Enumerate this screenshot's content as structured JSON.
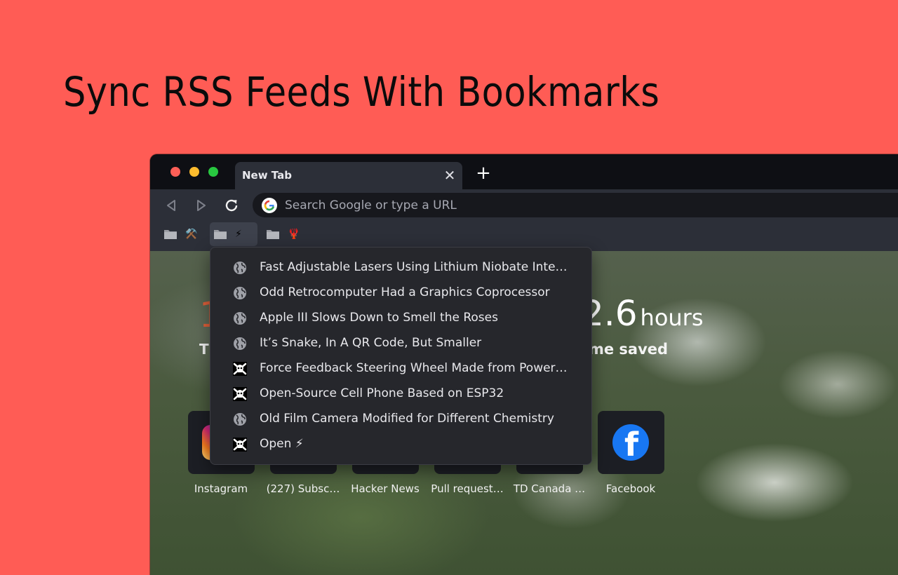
{
  "headline": "Sync RSS Feeds With Bookmarks",
  "colors": {
    "background": "#ff5c55",
    "accent_orange": "#e0603a",
    "facebook_blue": "#1877f2"
  },
  "browser": {
    "tab": {
      "title": "New Tab",
      "close_icon": "close-icon"
    },
    "new_tab_icon": "plus-icon",
    "nav": {
      "back_icon": "back-arrow-icon",
      "forward_icon": "forward-arrow-icon",
      "reload_icon": "reload-icon"
    },
    "omnibox": {
      "placeholder": "Search Google or type a URL",
      "icon": "google-icon"
    }
  },
  "bookmarks_bar": [
    {
      "icon": "folder-icon",
      "emoji": "⚒️"
    },
    {
      "icon": "folder-icon",
      "emoji": "⚡"
    },
    {
      "icon": "folder-icon",
      "emoji": "🦞"
    }
  ],
  "dropdown": {
    "items": [
      {
        "icon": "globe-icon",
        "label": "Fast Adjustable Lasers Using Lithium Niobate Integ…"
      },
      {
        "icon": "globe-icon",
        "label": "Odd Retrocomputer Had a Graphics Coprocessor"
      },
      {
        "icon": "globe-icon",
        "label": "Apple III Slows Down to Smell the Roses"
      },
      {
        "icon": "globe-icon",
        "label": "It’s Snake, In A QR Code, But Smaller"
      },
      {
        "icon": "skull-crossbones-icon",
        "label": "Force Feedback Steering Wheel Made from Power…"
      },
      {
        "icon": "skull-crossbones-icon",
        "label": "Open-Source Cell Phone Based on ESP32"
      },
      {
        "icon": "globe-icon",
        "label": "Old Film Camera Modified for Different Chemistry"
      },
      {
        "icon": "skull-crossbones-icon",
        "label": "Open ⚡"
      }
    ]
  },
  "newtab": {
    "stat_left": {
      "number": "1",
      "label": "T"
    },
    "stat_right": {
      "number": "2.6",
      "unit": "hours",
      "label": "me saved"
    },
    "shortcuts": [
      {
        "label": "Instagram",
        "icon": "instagram-icon"
      },
      {
        "label": "(227) Subsc…",
        "icon": "youtube-icon"
      },
      {
        "label": "Hacker News",
        "icon": "hacker-news-icon"
      },
      {
        "label": "Pull request…",
        "icon": "github-icon"
      },
      {
        "label": "TD Canada …",
        "icon": "td-bank-icon"
      },
      {
        "label": "Facebook",
        "icon": "facebook-icon"
      }
    ]
  }
}
